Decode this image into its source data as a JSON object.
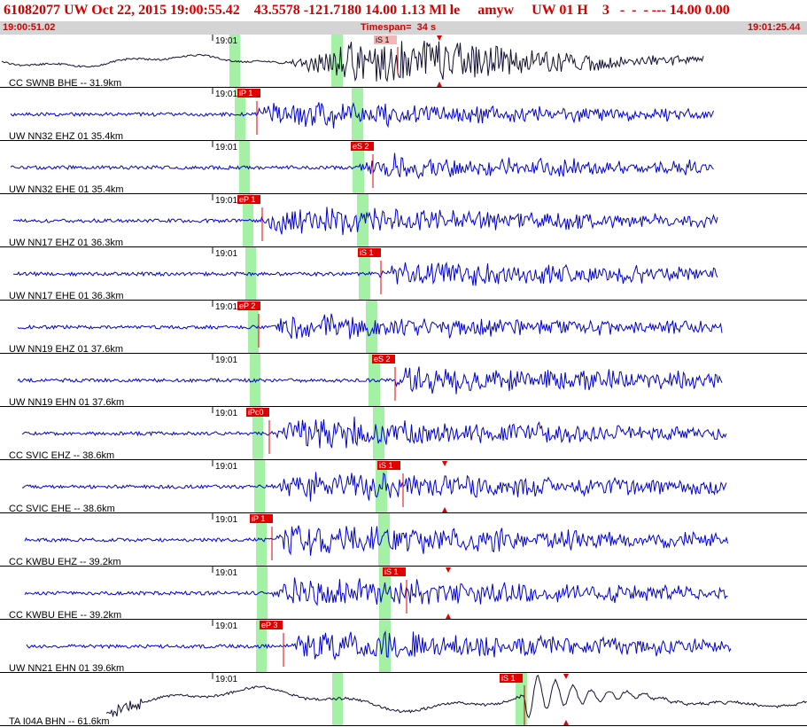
{
  "header": {
    "title": "61082077 UW Oct 22, 2015 19:00:55.42    43.5578 -121.7180 14.00 1.13 Ml le     amyw     UW 01 H    3   -  -  - --- 14.00 0.00",
    "start_time": "19:00:51.02",
    "timespan": "Timespan=  34 s",
    "end_time": "19:01:25.44"
  },
  "colors": {
    "title": "#d40000",
    "trace": "#0000d0",
    "trace_alt": "#101030",
    "pick_box": "#e00000",
    "pick_box_alt": "#f2b8b8",
    "window": "#a4f0a4"
  },
  "tracks": [
    {
      "label": "CC SWNB BHE -- 31.9km",
      "tick": "19:01",
      "pick": "iS 1",
      "style": "alt",
      "markers": true
    },
    {
      "label": "UW NN32 EHZ 01 35.4km",
      "tick": "19:01",
      "pick": "iP 1",
      "style": "main"
    },
    {
      "label": "UW NN32 EHE 01 35.4km",
      "tick": "19:01",
      "pick": "eS 2",
      "style": "main"
    },
    {
      "label": "UW NN17 EHZ 01 36.3km",
      "tick": "19:01",
      "pick": "eP 1",
      "style": "main"
    },
    {
      "label": "UW NN17 EHE 01 36.3km",
      "tick": "19:01",
      "pick": "iS 1",
      "style": "main"
    },
    {
      "label": "UW NN19 EHZ 01 37.6km",
      "tick": "19:01",
      "pick": "eP 2",
      "style": "main"
    },
    {
      "label": "UW NN19 EHN 01 37.6km",
      "tick": "19:01",
      "pick": "eS 2",
      "style": "main"
    },
    {
      "label": "CC SVIC EHZ -- 38.6km",
      "tick": "19:01",
      "pick": "iPc0",
      "style": "main"
    },
    {
      "label": "CC SVIC EHE -- 38.6km",
      "tick": "19:01",
      "pick": "iS 1",
      "style": "main",
      "markers": true
    },
    {
      "label": "CC KWBU EHZ -- 39.2km",
      "tick": "19:01",
      "pick": "iP 1",
      "style": "main"
    },
    {
      "label": "CC KWBU EHE -- 39.2km",
      "tick": "19:01",
      "pick": "iS 1",
      "style": "main",
      "markers": true
    },
    {
      "label": "UW NN21 EHN 01 39.6km",
      "tick": "19:01",
      "pick": "eP 3",
      "style": "main"
    },
    {
      "label": "TA I04A BHN -- 61.6km",
      "tick": "19:01",
      "pick": "iS 1",
      "style": "alt",
      "markers": true
    }
  ]
}
